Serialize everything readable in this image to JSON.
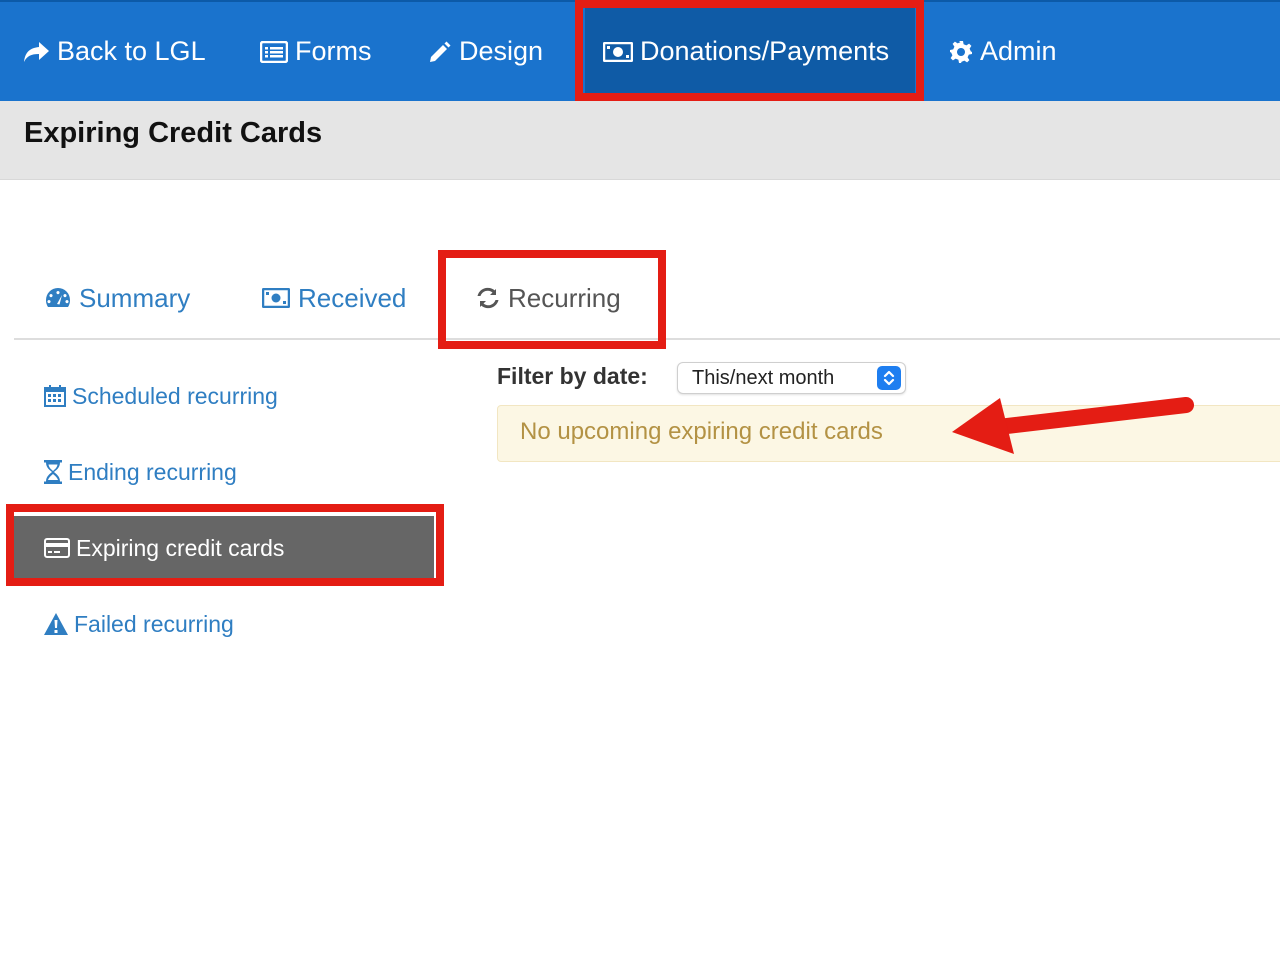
{
  "nav": {
    "back": "Back to LGL",
    "forms": "Forms",
    "design": "Design",
    "donations": "Donations/Payments",
    "admin": "Admin"
  },
  "page": {
    "title": "Expiring Credit Cards"
  },
  "tabs": {
    "summary": "Summary",
    "received": "Received",
    "recurring": "Recurring"
  },
  "sidebar": {
    "items": [
      {
        "label": "Scheduled recurring",
        "icon": "calendar-icon"
      },
      {
        "label": "Ending recurring",
        "icon": "hourglass-icon"
      },
      {
        "label": "Expiring credit cards",
        "icon": "credit-card-icon",
        "active": true
      },
      {
        "label": "Failed recurring",
        "icon": "warning-icon"
      }
    ]
  },
  "filter": {
    "label": "Filter by date:",
    "selected": "This/next month"
  },
  "alert": {
    "text": "No upcoming expiring credit cards"
  },
  "colors": {
    "nav_bg": "#1a73cd",
    "nav_active": "#0f5ba6",
    "link": "#2f7ec2",
    "highlight": "#e41d14",
    "alert_bg": "#fcf7e4",
    "alert_text": "#b39244"
  }
}
